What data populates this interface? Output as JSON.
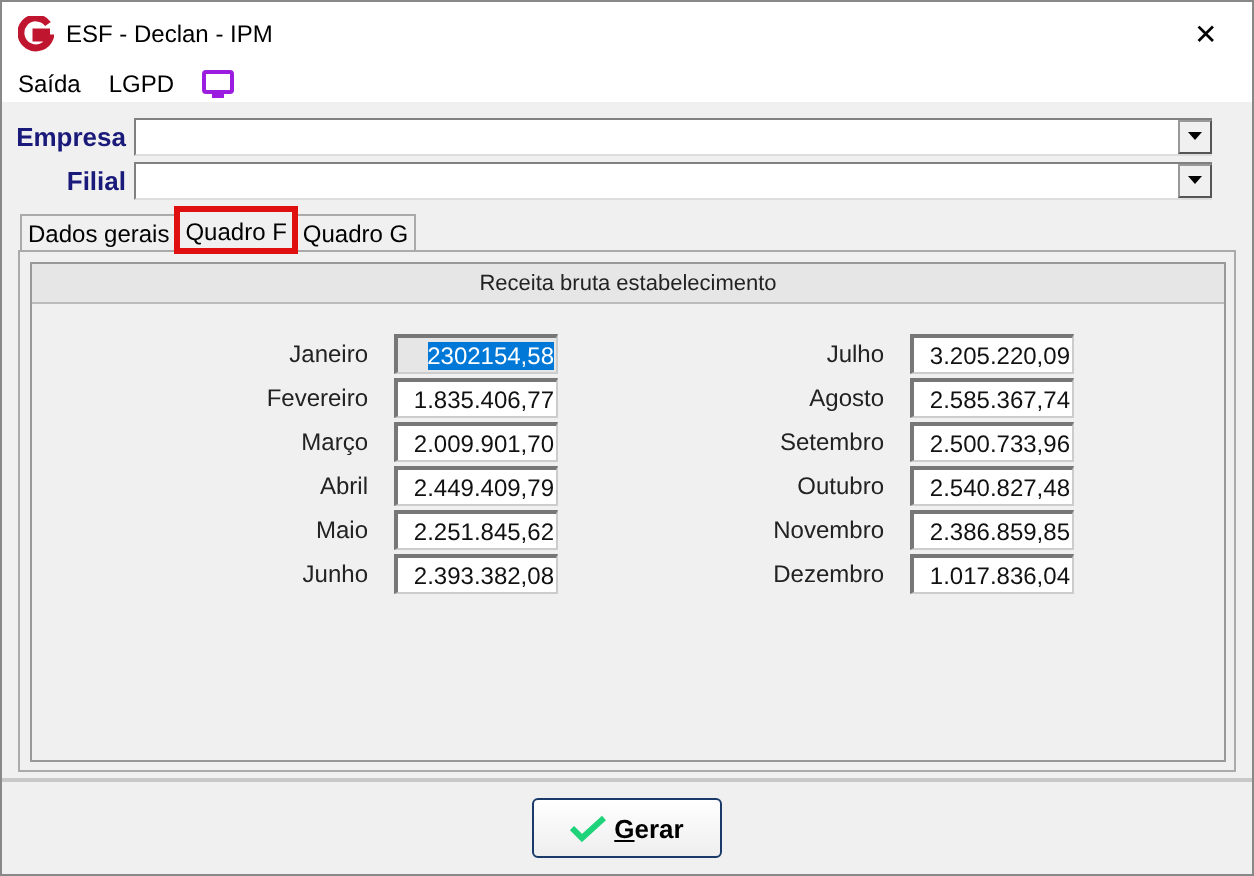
{
  "window": {
    "title": "ESF - Declan - IPM",
    "close": "✕"
  },
  "menu": [
    {
      "label": "Saída"
    },
    {
      "label": "LGPD"
    }
  ],
  "fields": [
    {
      "label": "Empresa"
    },
    {
      "label": "Filial"
    }
  ],
  "tabs": [
    {
      "label": "Dados gerais",
      "selected": false,
      "highlighted": false
    },
    {
      "label": "Quadro F",
      "selected": true,
      "highlighted": true
    },
    {
      "label": "Quadro G",
      "selected": false,
      "highlighted": false
    }
  ],
  "group": {
    "title": "Receita bruta estabelecimento"
  },
  "months": [
    {
      "label": "Janeiro",
      "value": "2302154,58",
      "selected": true
    },
    {
      "label": "Fevereiro",
      "value": "1.835.406,77",
      "selected": false
    },
    {
      "label": "Março",
      "value": "2.009.901,70",
      "selected": false
    },
    {
      "label": "Abril",
      "value": "2.449.409,79",
      "selected": false
    },
    {
      "label": "Maio",
      "value": "2.251.845,62",
      "selected": false
    },
    {
      "label": "Junho",
      "value": "2.393.382,08",
      "selected": false
    },
    {
      "label": "Julho",
      "value": "3.205.220,09",
      "selected": false
    },
    {
      "label": "Agosto",
      "value": "2.585.367,74",
      "selected": false
    },
    {
      "label": "Setembro",
      "value": "2.500.733,96",
      "selected": false
    },
    {
      "label": "Outubro",
      "value": "2.540.827,48",
      "selected": false
    },
    {
      "label": "Novembro",
      "value": "2.386.859,85",
      "selected": false
    },
    {
      "label": "Dezembro",
      "value": "1.017.836,04",
      "selected": false
    }
  ],
  "button": {
    "label": "Gerar"
  }
}
